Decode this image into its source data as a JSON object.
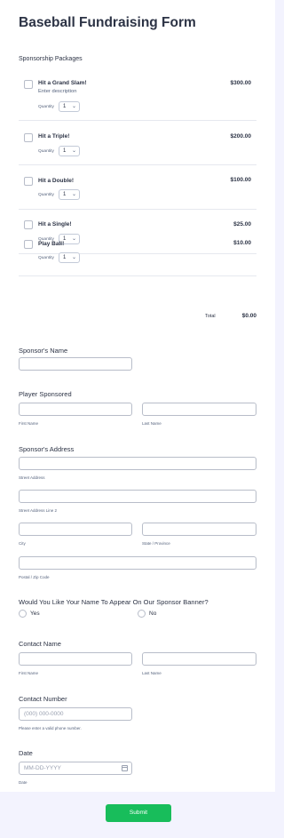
{
  "form": {
    "title": "Baseball Fundraising Form"
  },
  "sponsorship": {
    "label": "Sponsorship Packages",
    "quantity_label": "Quantity",
    "products": [
      {
        "name": "Hit a Grand Slam!",
        "description": "Enter description",
        "price": "$300.00",
        "quantity": "1"
      },
      {
        "name": "Hit a Triple!",
        "price": "$200.00",
        "quantity": "1"
      },
      {
        "name": "Hit a Double!",
        "price": "$100.00",
        "quantity": "1"
      },
      {
        "name": "Hit a Single!",
        "price": "$25.00",
        "quantity": "1"
      },
      {
        "name": "Play Ball!",
        "price": "$10.00",
        "quantity": "1"
      }
    ],
    "total_label": "Total",
    "total_value": "$0.00"
  },
  "sponsor_name": {
    "label": "Sponsor's Name",
    "value": ""
  },
  "player": {
    "label": "Player Sponsored",
    "first_sub": "First Name",
    "last_sub": "Last Name"
  },
  "address": {
    "label": "Sponsor's Address",
    "street_sub": "Street Address",
    "street2_sub": "Street Address Line 2",
    "city_sub": "City",
    "state_sub": "State / Province",
    "zip_sub": "Postal / Zip Code"
  },
  "banner": {
    "label": "Would You Like Your Name To Appear On Our Sponsor Banner?",
    "options": [
      "Yes",
      "No"
    ]
  },
  "contact": {
    "label": "Contact Name",
    "first_sub": "First Name",
    "last_sub": "Last Name"
  },
  "phone": {
    "label": "Contact Number",
    "placeholder": "(000) 000-0000",
    "sub": "Please enter a valid phone number."
  },
  "date": {
    "label": "Date",
    "placeholder": "MM-DD-YYYY",
    "sub": "Date"
  },
  "submit": {
    "label": "Submit"
  },
  "colors": {
    "accent": "#18bd5b",
    "text": "#2c3345",
    "background": "#f3f3fe"
  }
}
